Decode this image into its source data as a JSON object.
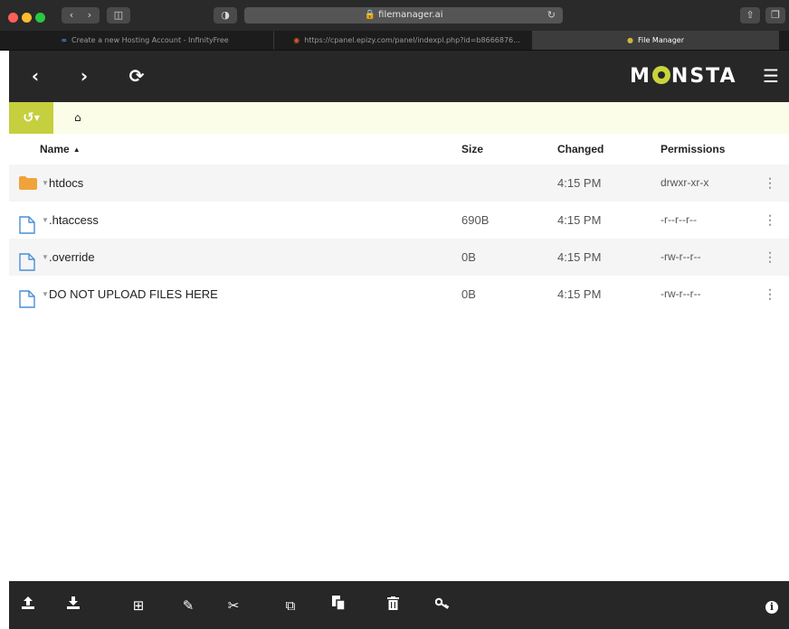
{
  "browser": {
    "url": "filemanager.ai",
    "tabs": [
      {
        "label": "Create a new Hosting Account - InfinityFree",
        "favicon": "infinityfree-icon",
        "active": false
      },
      {
        "label": "https://cpanel.epizy.com/panel/indexpl.php?id=b8666876...",
        "favicon": "cpanel-icon",
        "active": false
      },
      {
        "label": "File Manager",
        "favicon": "monsta-icon",
        "active": true
      }
    ]
  },
  "app": {
    "logo": "MONSTA",
    "accent_color": "#c6cf3d",
    "bar_color": "#272727"
  },
  "breadcrumb": {
    "home_icon": "home-icon"
  },
  "table": {
    "columns": {
      "name": "Name",
      "size": "Size",
      "changed": "Changed",
      "permissions": "Permissions"
    },
    "sort": {
      "column": "name",
      "direction": "ascending"
    },
    "rows": [
      {
        "type": "folder",
        "name": "htdocs",
        "size": "",
        "changed": "4:15 PM",
        "permissions": "drwxr-xr-x"
      },
      {
        "type": "file",
        "name": ".htaccess",
        "size": "690B",
        "changed": "4:15 PM",
        "permissions": "-r--r--r--"
      },
      {
        "type": "file",
        "name": ".override",
        "size": "0B",
        "changed": "4:15 PM",
        "permissions": "-rw-r--r--"
      },
      {
        "type": "file",
        "name": "DO NOT UPLOAD FILES HERE",
        "size": "0B",
        "changed": "4:15 PM",
        "permissions": "-rw-r--r--"
      }
    ]
  },
  "toolbar": {
    "icons": [
      "upload-icon",
      "download-icon",
      "new-item-icon",
      "edit-icon",
      "cut-icon",
      "copy-icon",
      "paste-icon",
      "delete-icon",
      "permissions-key-icon",
      "info-icon"
    ]
  }
}
